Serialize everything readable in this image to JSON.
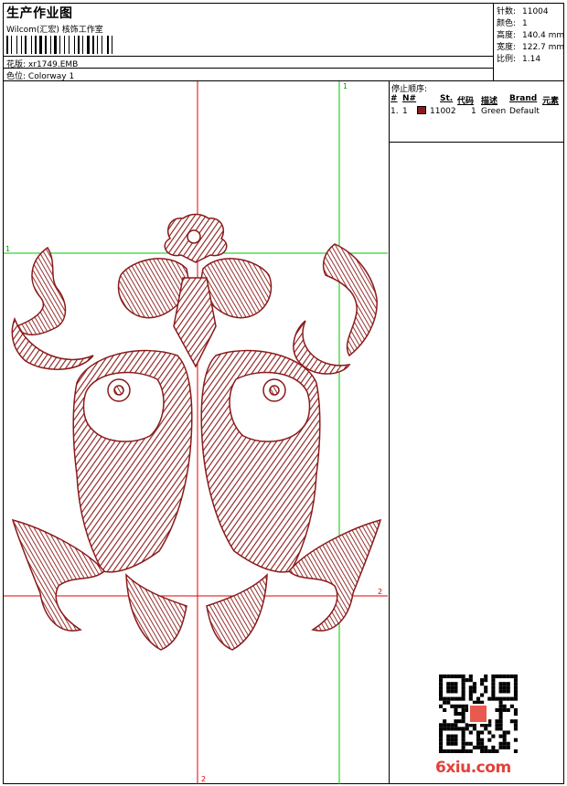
{
  "header": {
    "title": "生产作业图",
    "subtitle": "Wilcom(汇宏) 核饰工作室",
    "design_label": "花版:",
    "design_value": "xr1749.EMB",
    "colorway_label": "色位:",
    "colorway_value": "Colorway 1"
  },
  "stats": [
    {
      "label": "针数:",
      "value": "11004"
    },
    {
      "label": "颜色:",
      "value": "1"
    },
    {
      "label": "高度:",
      "value": "140.4 mm"
    },
    {
      "label": "宽度:",
      "value": "122.7 mm"
    },
    {
      "label": "比例:",
      "value": "1.14"
    }
  ],
  "sequence": {
    "title": "停止顺序:",
    "columns": [
      "#",
      "N#",
      "St.",
      "代码",
      "描述",
      "Brand",
      "元素"
    ],
    "rows": [
      {
        "index": "1.",
        "needle": "1",
        "code": "11002",
        "stops": "1",
        "description": "Green",
        "brand": "Default",
        "swatch_color": "#8b1a1a"
      }
    ]
  },
  "guides": {
    "v1": "1",
    "h1": "1",
    "h2": "2",
    "v2": "2"
  },
  "watermark": "6xiu.com",
  "colors": {
    "thread": "#8b1a1a",
    "guide_red": "#e00000",
    "guide_green": "#00c800"
  }
}
